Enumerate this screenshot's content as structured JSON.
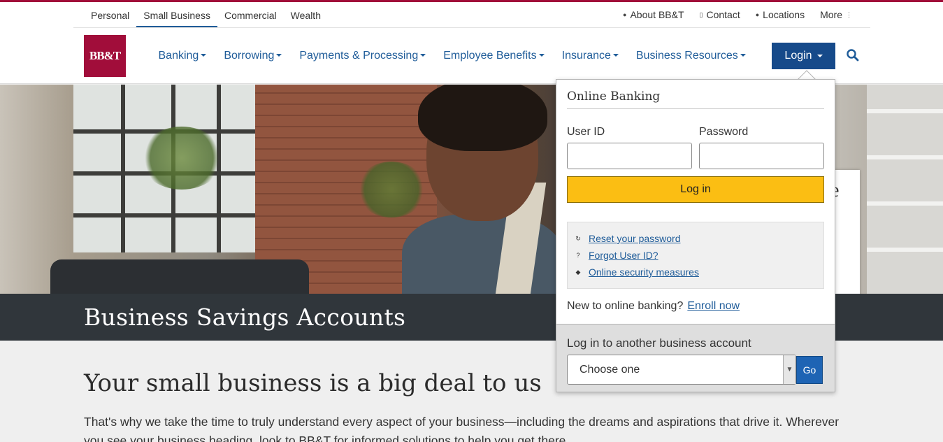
{
  "utility": {
    "segments": [
      {
        "label": "Personal"
      },
      {
        "label": "Small Business",
        "active": true
      },
      {
        "label": "Commercial"
      },
      {
        "label": "Wealth"
      }
    ],
    "links": [
      {
        "label": "About BB&T",
        "icon": "person-icon"
      },
      {
        "label": "Contact",
        "icon": "phone-icon"
      },
      {
        "label": "Locations",
        "icon": "map-pin-icon"
      },
      {
        "label": "More",
        "icon": "more-vertical-icon"
      }
    ]
  },
  "brand": {
    "logo_text": "BB&T",
    "color": "#a10d3a"
  },
  "nav": {
    "items": [
      {
        "label": "Banking"
      },
      {
        "label": "Borrowing"
      },
      {
        "label": "Payments & Processing"
      },
      {
        "label": "Employee Benefits"
      },
      {
        "label": "Insurance"
      },
      {
        "label": "Business Resources"
      }
    ],
    "login_label": "Login",
    "search_icon": "search-icon"
  },
  "hero": {
    "teaser_char": "e"
  },
  "page": {
    "title": "Business Savings Accounts",
    "heading": "Your small business is a big deal to us",
    "paragraph": "That's why we take the time to truly understand every aspect of your business—including the dreams and aspirations that drive it. Wherever you see your business heading, look to BB&T for informed solutions to help you get there."
  },
  "login_panel": {
    "title": "Online Banking",
    "user_id_label": "User ID",
    "password_label": "Password",
    "user_id_value": "",
    "password_value": "",
    "submit_label": "Log in",
    "help_links": [
      {
        "label": "Reset your password",
        "icon": "refresh-icon"
      },
      {
        "label": "Forgot User ID?",
        "icon": "question-icon"
      },
      {
        "label": "Online security measures",
        "icon": "shield-icon"
      }
    ],
    "new_user_text": "New to online banking?",
    "enroll_label": "Enroll now",
    "other_account_label": "Log in to another business account",
    "select_value": "Choose one",
    "go_label": "Go"
  },
  "colors": {
    "brand": "#a10d3a",
    "nav_link": "#1f5c99",
    "login_button": "#164a8a",
    "submit_button": "#fbbe13",
    "title_band": "#30363b",
    "go_button": "#1e64b4"
  }
}
